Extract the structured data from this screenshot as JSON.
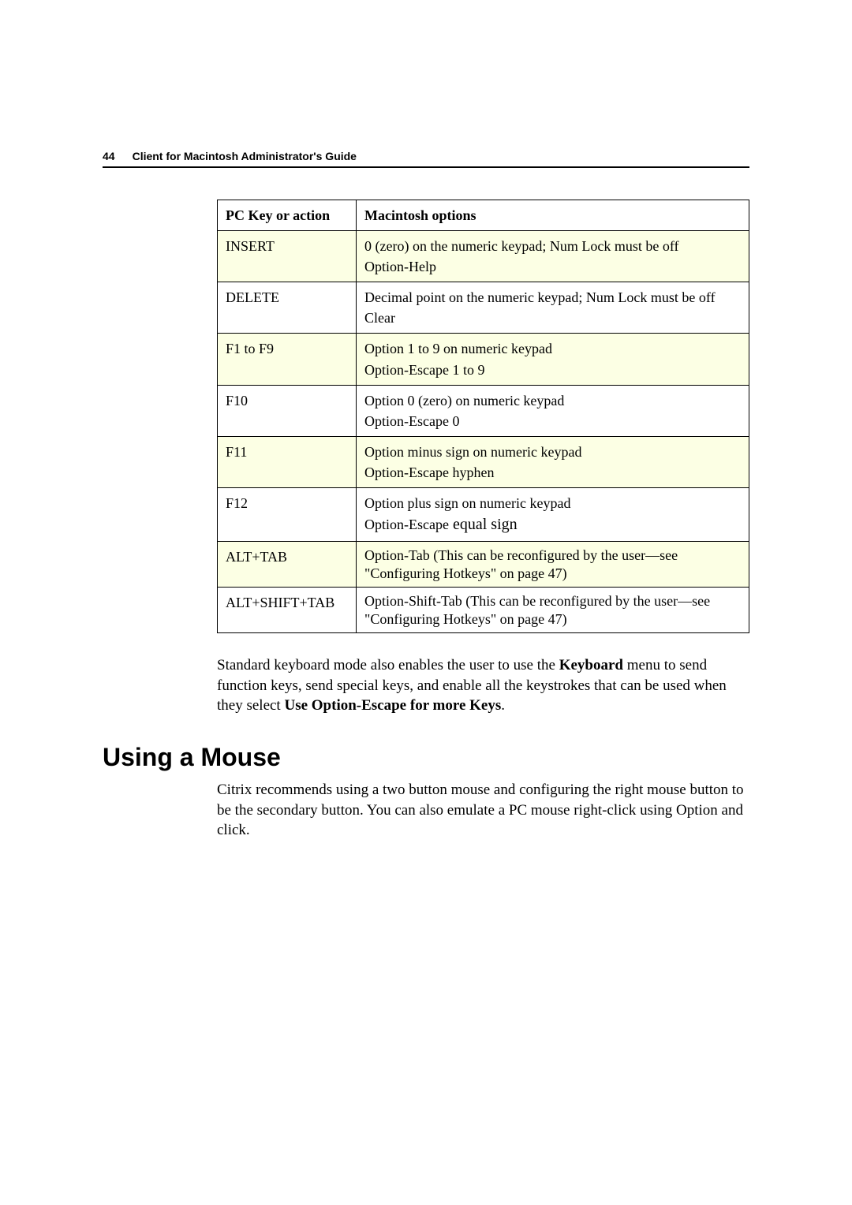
{
  "header": {
    "page_number": "44",
    "title": "Client for Macintosh Administrator's Guide"
  },
  "table": {
    "head": {
      "c1": "PC Key or action",
      "c2": "Macintosh options"
    },
    "rows": [
      {
        "shade": true,
        "c1": "INSERT",
        "c2_a": "0 (zero) on the numeric keypad; Num Lock must be off",
        "c2_b": "Option-Help"
      },
      {
        "shade": false,
        "c1": "DELETE",
        "c2_a": "Decimal point on the numeric keypad; Num Lock must be off",
        "c2_b": "Clear"
      },
      {
        "shade": true,
        "c1": "F1 to F9",
        "c2_a": "Option 1 to 9 on numeric keypad",
        "c2_b": "Option-Escape 1 to 9"
      },
      {
        "shade": false,
        "c1": "F10",
        "c2_a": "Option 0 (zero) on numeric keypad",
        "c2_b": "Option-Escape 0"
      },
      {
        "shade": true,
        "c1": "F11",
        "c2_a": "Option minus sign on numeric keypad",
        "c2_b": "Option-Escape hyphen"
      },
      {
        "shade": false,
        "c1": "F12",
        "c2_a": "Option plus sign on numeric keypad",
        "c2_b_prefix": "Option-Escape",
        "c2_b_suffix": " equal sign"
      },
      {
        "shade": true,
        "c1": "ALT+TAB",
        "c2_single": "Option-Tab (This can be reconfigured by the user—see \"Configuring Hotkeys\" on page 47)"
      },
      {
        "shade": false,
        "c1": "ALT+SHIFT+TAB",
        "c2_single": "Option-Shift-Tab (This can be reconfigured by the user—see \"Configuring Hotkeys\" on page 47)"
      }
    ]
  },
  "para1": {
    "a": "Standard keyboard mode also enables the user to use the ",
    "b": "Keyboard",
    "c": " menu to send function keys, send special keys, and enable all the keystrokes that can be used when they select ",
    "d": "Use Option-Escape for more Keys",
    "e": "."
  },
  "heading": "Using a Mouse",
  "para2": "Citrix recommends using a two button mouse and configuring the right mouse button to be the secondary button. You can also emulate a PC mouse right-click using Option and click."
}
